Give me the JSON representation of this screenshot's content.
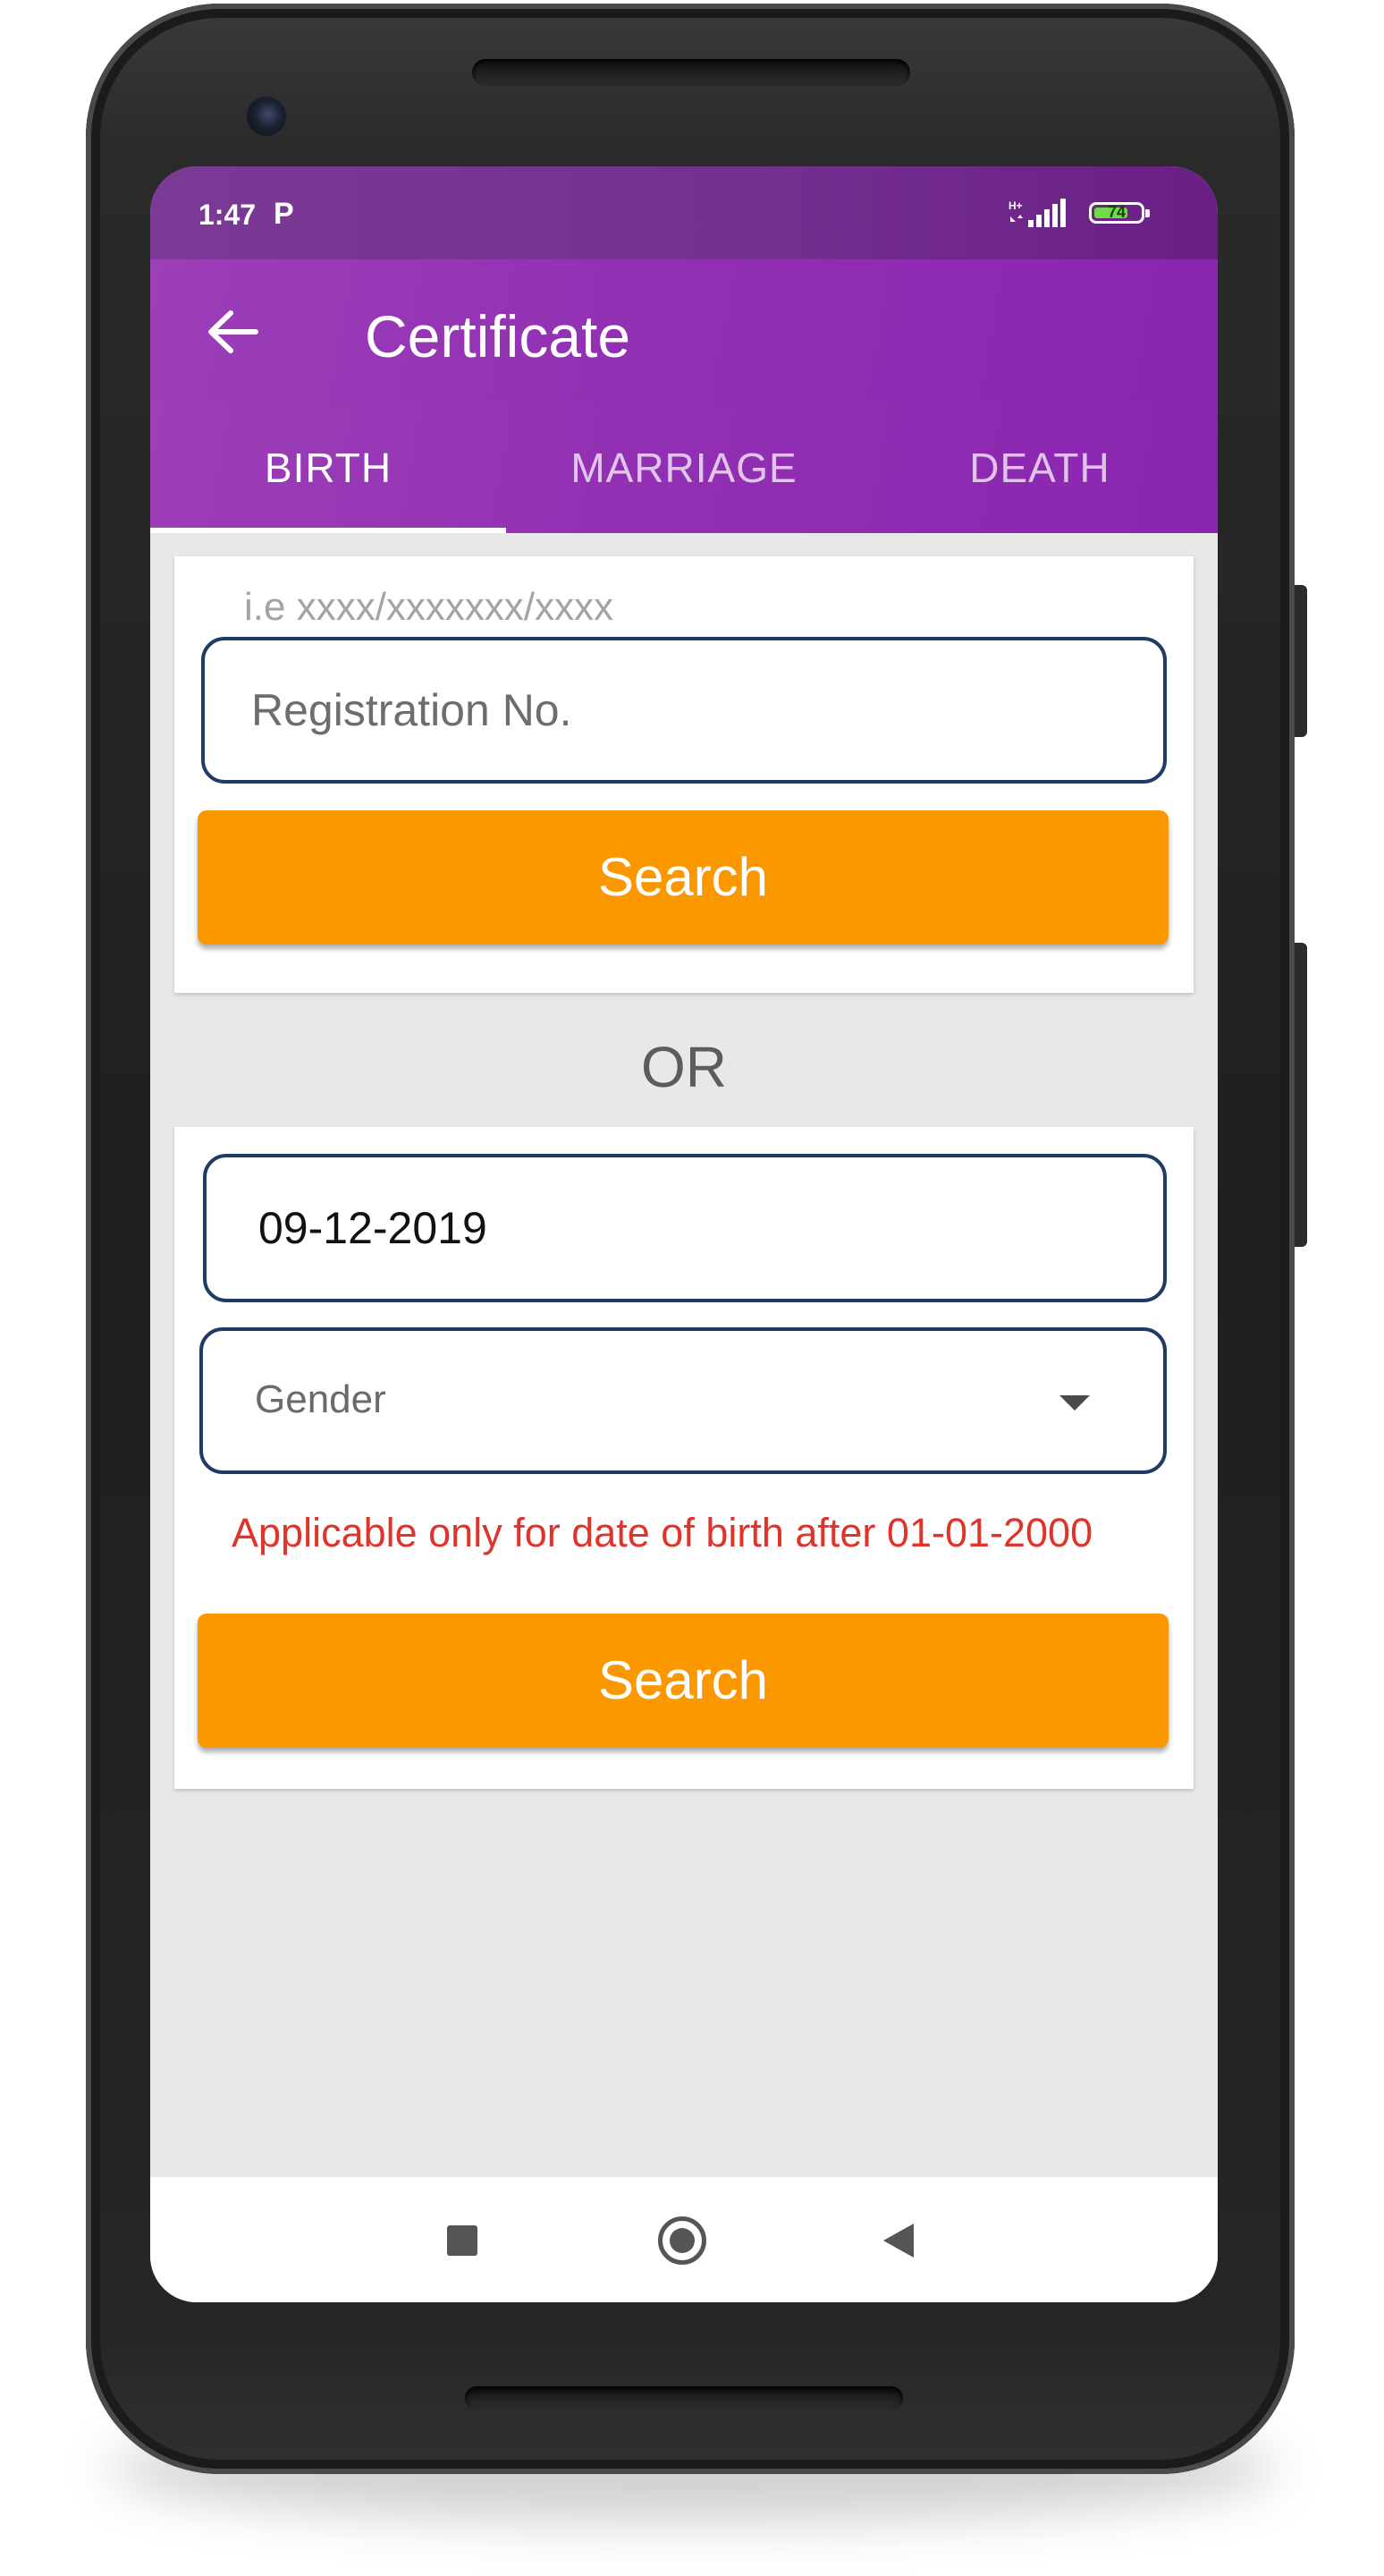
{
  "status_bar": {
    "time": "1:47",
    "notification_icon": "P",
    "signal_icon": "signal-icon",
    "battery_level": "74",
    "battery_fraction": 0.74
  },
  "app_bar": {
    "back_icon": "arrow-left-icon",
    "title": "Certificate"
  },
  "tabs": [
    {
      "label": "BIRTH",
      "active": true
    },
    {
      "label": "MARRIAGE",
      "active": false
    },
    {
      "label": "DEATH",
      "active": false
    }
  ],
  "registration_search": {
    "hint": "i.e xxxx/xxxxxxx/xxxx",
    "input_placeholder": "Registration No.",
    "input_value": "",
    "search_label": "Search"
  },
  "separator": "OR",
  "date_search": {
    "date_value": "09-12-2019",
    "gender_label": "Gender",
    "warning": "Applicable only for date of birth after 01-01-2000",
    "search_label": "Search"
  },
  "colors": {
    "primary": "#9230b3",
    "accent": "#fb9800",
    "field_border": "#1f3b66",
    "warning_text": "#e0342b"
  },
  "nav_bar": {
    "recents_icon": "square-icon",
    "home_icon": "circle-icon",
    "back_icon": "triangle-back-icon"
  }
}
